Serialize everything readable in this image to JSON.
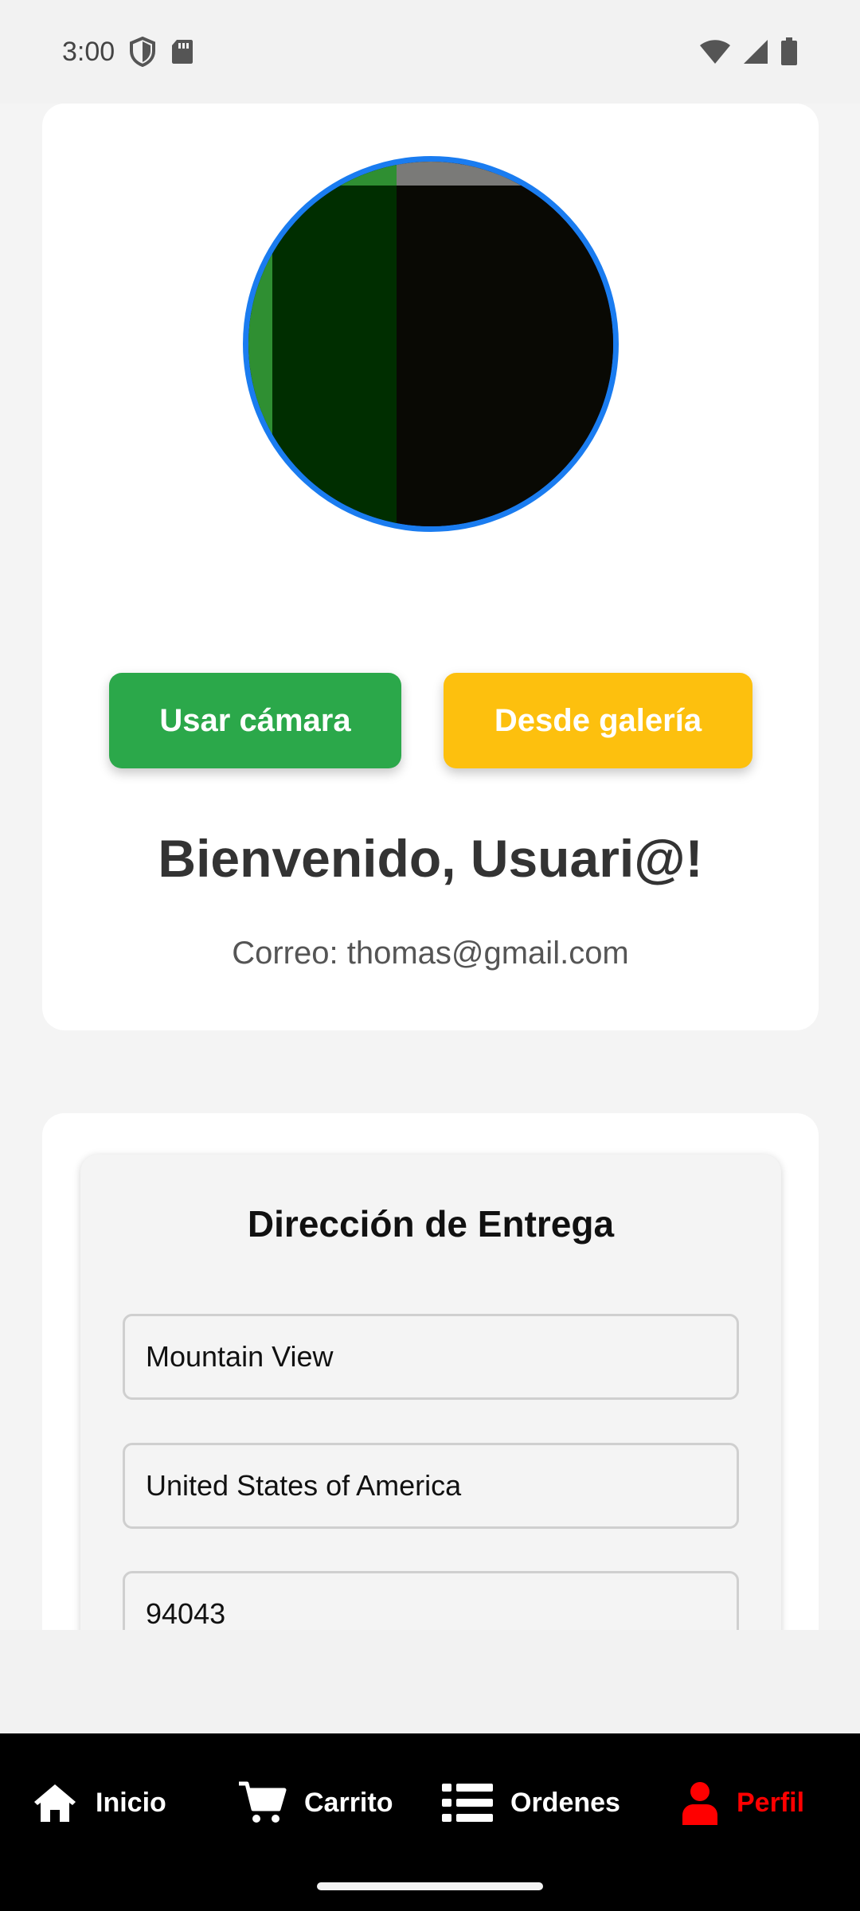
{
  "status_bar": {
    "time": "3:00",
    "left_icons": [
      "shield-icon",
      "sd-card-icon"
    ],
    "right_icons": [
      "wifi-icon",
      "cell-signal-icon",
      "battery-icon"
    ]
  },
  "profile": {
    "avatar_alt": "profile-photo",
    "camera_button": "Usar cámara",
    "gallery_button": "Desde galería",
    "welcome": "Bienvenido, Usuari@!",
    "email_line": "Correo: thomas@gmail.com"
  },
  "address": {
    "title": "Dirección de Entrega",
    "fields": [
      {
        "value": "Mountain View"
      },
      {
        "value": "United States of America"
      },
      {
        "value": "94043"
      }
    ]
  },
  "bottom_nav": {
    "items": [
      {
        "label": "Inicio",
        "icon": "home-icon",
        "active": false
      },
      {
        "label": "Carrito",
        "icon": "cart-icon",
        "active": false
      },
      {
        "label": "Ordenes",
        "icon": "list-icon",
        "active": false
      },
      {
        "label": "Perfil",
        "icon": "user-icon",
        "active": true
      }
    ],
    "active_color": "#ff0000"
  },
  "colors": {
    "camera_button": "#2ba84a",
    "gallery_button": "#fdc00e",
    "avatar_border": "#1a7cf0"
  }
}
